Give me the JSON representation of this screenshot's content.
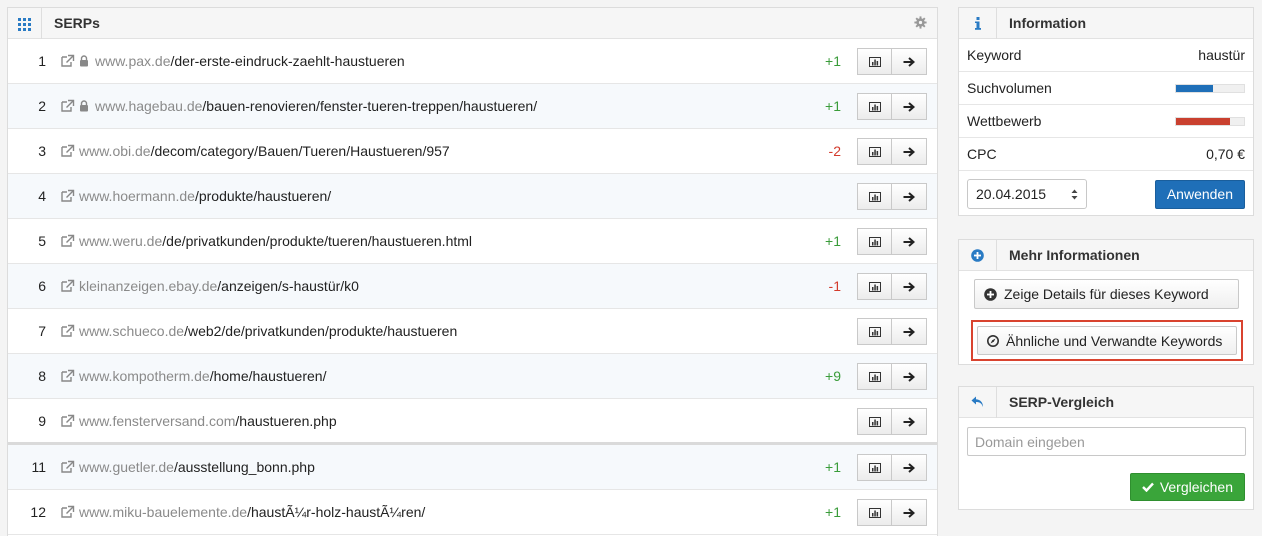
{
  "serps": {
    "title": "SERPs",
    "rows": [
      {
        "rank": "1",
        "lock": true,
        "domain": "www.pax.de",
        "path": "/der-erste-eindruck-zaehlt-haustueren",
        "change": "+1",
        "dir": "up"
      },
      {
        "rank": "2",
        "lock": true,
        "domain": "www.hagebau.de",
        "path": "/bauen-renovieren/fenster-tueren-treppen/haustueren/",
        "change": "+1",
        "dir": "up"
      },
      {
        "rank": "3",
        "lock": false,
        "domain": "www.obi.de",
        "path": "/decom/category/Bauen/Tueren/Haustueren/957",
        "change": "-2",
        "dir": "down"
      },
      {
        "rank": "4",
        "lock": false,
        "domain": "www.hoermann.de",
        "path": "/produkte/haustueren/",
        "change": "",
        "dir": ""
      },
      {
        "rank": "5",
        "lock": false,
        "domain": "www.weru.de",
        "path": "/de/privatkunden/produkte/tueren/haustueren.html",
        "change": "+1",
        "dir": "up"
      },
      {
        "rank": "6",
        "lock": false,
        "domain": "kleinanzeigen.ebay.de",
        "path": "/anzeigen/s-haustür/k0",
        "change": "-1",
        "dir": "down"
      },
      {
        "rank": "7",
        "lock": false,
        "domain": "www.schueco.de",
        "path": "/web2/de/privatkunden/produkte/haustueren",
        "change": "",
        "dir": ""
      },
      {
        "rank": "8",
        "lock": false,
        "domain": "www.kompotherm.de",
        "path": "/home/haustueren/",
        "change": "+9",
        "dir": "up"
      },
      {
        "rank": "9",
        "lock": false,
        "domain": "www.fensterversand.com",
        "path": "/haustueren.php",
        "change": "",
        "dir": ""
      },
      {
        "rank": "11",
        "lock": false,
        "domain": "www.guetler.de",
        "path": "/ausstellung_bonn.php",
        "change": "+1",
        "dir": "up"
      },
      {
        "rank": "12",
        "lock": false,
        "domain": "www.miku-bauelemente.de",
        "path": "/haustÃ¼r-holz-haustÃ¼ren/",
        "change": "+1",
        "dir": "up"
      }
    ]
  },
  "info": {
    "title": "Information",
    "keyword_label": "Keyword",
    "keyword_value": "haustür",
    "volume_label": "Suchvolumen",
    "volume_level": 0.55,
    "volume_color": "#1f6fb8",
    "competition_label": "Wettbewerb",
    "competition_level": 0.8,
    "competition_color": "#c9402f",
    "cpc_label": "CPC",
    "cpc_value": "0,70 €",
    "date_value": "20.04.2015",
    "apply_label": "Anwenden"
  },
  "more": {
    "title": "Mehr Informationen",
    "details_label": "Zeige Details für dieses Keyword",
    "related_label": "Ähnliche und Verwandte Keywords"
  },
  "compare": {
    "title": "SERP-Vergleich",
    "domain_placeholder": "Domain eingeben",
    "compare_label": "Vergleichen"
  },
  "colors": {
    "accent": "#2a7bc4",
    "positive": "#3a9c3a",
    "negative": "#d33b2c",
    "highlight": "#d9432f"
  }
}
